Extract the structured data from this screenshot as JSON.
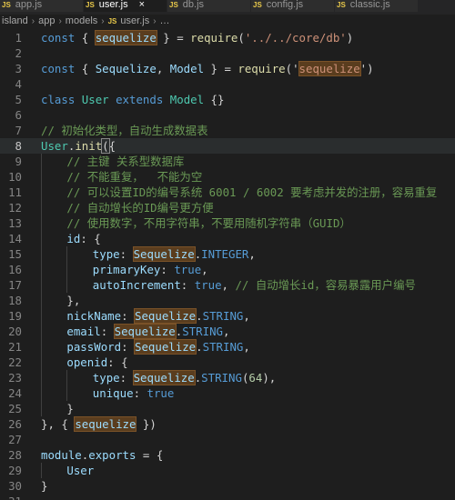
{
  "tabs": [
    {
      "label": "app.js",
      "active": false
    },
    {
      "label": "user.js",
      "active": true,
      "close": "×"
    },
    {
      "label": "db.js",
      "active": false
    },
    {
      "label": "config.js",
      "active": false
    },
    {
      "label": "classic.js",
      "active": false
    }
  ],
  "tab_icon": "JS",
  "breadcrumb": {
    "items": [
      "island",
      "app",
      "models",
      "user.js",
      "…"
    ],
    "separator": "›"
  },
  "code": {
    "current_line": 8,
    "lines": [
      {
        "n": "1",
        "tokens": [
          {
            "t": "const",
            "c": "kw"
          },
          {
            "t": " { "
          },
          {
            "t": "sequelize",
            "c": "vr hl"
          },
          {
            "t": " } = "
          },
          {
            "t": "require",
            "c": "fn"
          },
          {
            "t": "("
          },
          {
            "t": "'../../core/db'",
            "c": "str"
          },
          {
            "t": ")"
          }
        ]
      },
      {
        "n": "2",
        "tokens": []
      },
      {
        "n": "3",
        "tokens": [
          {
            "t": "const",
            "c": "kw"
          },
          {
            "t": " { "
          },
          {
            "t": "Sequelize",
            "c": "vr"
          },
          {
            "t": ", "
          },
          {
            "t": "Model",
            "c": "vr"
          },
          {
            "t": " } = "
          },
          {
            "t": "require",
            "c": "fn"
          },
          {
            "t": "('"
          },
          {
            "t": "sequelize",
            "c": "str hl"
          },
          {
            "t": "')"
          }
        ]
      },
      {
        "n": "4",
        "tokens": []
      },
      {
        "n": "5",
        "tokens": [
          {
            "t": "class",
            "c": "kw"
          },
          {
            "t": " "
          },
          {
            "t": "User",
            "c": "cls"
          },
          {
            "t": " "
          },
          {
            "t": "extends",
            "c": "kw"
          },
          {
            "t": " "
          },
          {
            "t": "Model",
            "c": "cls"
          },
          {
            "t": " {}"
          }
        ]
      },
      {
        "n": "6",
        "tokens": []
      },
      {
        "n": "7",
        "tokens": [
          {
            "t": "// 初始化类型，自动生成数据表",
            "c": "cm"
          }
        ]
      },
      {
        "n": "8",
        "tokens": [
          {
            "t": "User",
            "c": "cls"
          },
          {
            "t": "."
          },
          {
            "t": "init",
            "c": "fn"
          },
          {
            "t": "(",
            "c": "pn bm"
          },
          {
            "t": "{"
          }
        ]
      },
      {
        "n": "9",
        "indent": 1,
        "tokens": [
          {
            "t": "// 主键 关系型数据库",
            "c": "cm"
          }
        ]
      },
      {
        "n": "10",
        "indent": 1,
        "tokens": [
          {
            "t": "// 不能重复，  不能为空",
            "c": "cm"
          }
        ]
      },
      {
        "n": "11",
        "indent": 1,
        "tokens": [
          {
            "t": "// 可以设置ID的编号系统 6001 / 6002 要考虑并发的注册，容易重复",
            "c": "cm"
          }
        ]
      },
      {
        "n": "12",
        "indent": 1,
        "tokens": [
          {
            "t": "// 自动增长的ID编号更方便",
            "c": "cm"
          }
        ]
      },
      {
        "n": "13",
        "indent": 1,
        "tokens": [
          {
            "t": "// 使用数字，不用字符串，不要用随机字符串（GUID）",
            "c": "cm"
          }
        ]
      },
      {
        "n": "14",
        "indent": 1,
        "tokens": [
          {
            "t": "id",
            "c": "vr"
          },
          {
            "t": ": {"
          }
        ]
      },
      {
        "n": "15",
        "indent": 2,
        "tokens": [
          {
            "t": "type",
            "c": "vr"
          },
          {
            "t": ": "
          },
          {
            "t": "Sequelize",
            "c": "vr hl"
          },
          {
            "t": "."
          },
          {
            "t": "INTEGER",
            "c": "kw"
          },
          {
            "t": ","
          }
        ]
      },
      {
        "n": "16",
        "indent": 2,
        "tokens": [
          {
            "t": "primaryKey",
            "c": "vr"
          },
          {
            "t": ": "
          },
          {
            "t": "true",
            "c": "kw"
          },
          {
            "t": ","
          }
        ]
      },
      {
        "n": "17",
        "indent": 2,
        "tokens": [
          {
            "t": "autoIncrement",
            "c": "vr"
          },
          {
            "t": ": "
          },
          {
            "t": "true",
            "c": "kw"
          },
          {
            "t": ", "
          },
          {
            "t": "// 自动增长id，容易暴露用户编号",
            "c": "cm"
          }
        ]
      },
      {
        "n": "18",
        "indent": 1,
        "tokens": [
          {
            "t": "},"
          }
        ]
      },
      {
        "n": "19",
        "indent": 1,
        "tokens": [
          {
            "t": "nickName",
            "c": "vr"
          },
          {
            "t": ": "
          },
          {
            "t": "Sequelize",
            "c": "vr hl"
          },
          {
            "t": "."
          },
          {
            "t": "STRING",
            "c": "kw"
          },
          {
            "t": ","
          }
        ]
      },
      {
        "n": "20",
        "indent": 1,
        "tokens": [
          {
            "t": "email",
            "c": "vr"
          },
          {
            "t": ": "
          },
          {
            "t": "Sequelize",
            "c": "vr hl"
          },
          {
            "t": "."
          },
          {
            "t": "STRING",
            "c": "kw"
          },
          {
            "t": ","
          }
        ]
      },
      {
        "n": "21",
        "indent": 1,
        "tokens": [
          {
            "t": "passWord",
            "c": "vr"
          },
          {
            "t": ": "
          },
          {
            "t": "Sequelize",
            "c": "vr hl"
          },
          {
            "t": "."
          },
          {
            "t": "STRING",
            "c": "kw"
          },
          {
            "t": ","
          }
        ]
      },
      {
        "n": "22",
        "indent": 1,
        "tokens": [
          {
            "t": "openid",
            "c": "vr"
          },
          {
            "t": ": {"
          }
        ]
      },
      {
        "n": "23",
        "indent": 2,
        "tokens": [
          {
            "t": "type",
            "c": "vr"
          },
          {
            "t": ": "
          },
          {
            "t": "Sequelize",
            "c": "vr hl"
          },
          {
            "t": "."
          },
          {
            "t": "STRING",
            "c": "kw"
          },
          {
            "t": "("
          },
          {
            "t": "64",
            "c": "num"
          },
          {
            "t": "),"
          }
        ]
      },
      {
        "n": "24",
        "indent": 2,
        "tokens": [
          {
            "t": "unique",
            "c": "vr"
          },
          {
            "t": ": "
          },
          {
            "t": "true",
            "c": "kw"
          }
        ]
      },
      {
        "n": "25",
        "indent": 1,
        "tokens": [
          {
            "t": "}"
          }
        ]
      },
      {
        "n": "26",
        "tokens": [
          {
            "t": "}"
          },
          {
            "t": ", { "
          },
          {
            "t": "sequelize",
            "c": "vr hl"
          },
          {
            "t": " })"
          }
        ]
      },
      {
        "n": "27",
        "tokens": []
      },
      {
        "n": "28",
        "tokens": [
          {
            "t": "module",
            "c": "vr"
          },
          {
            "t": "."
          },
          {
            "t": "exports",
            "c": "vr"
          },
          {
            "t": " = {"
          }
        ]
      },
      {
        "n": "29",
        "indent": 1,
        "tokens": [
          {
            "t": "User",
            "c": "vr"
          }
        ]
      },
      {
        "n": "30",
        "tokens": [
          {
            "t": "}"
          }
        ]
      },
      {
        "n": "31",
        "tokens": []
      }
    ]
  }
}
